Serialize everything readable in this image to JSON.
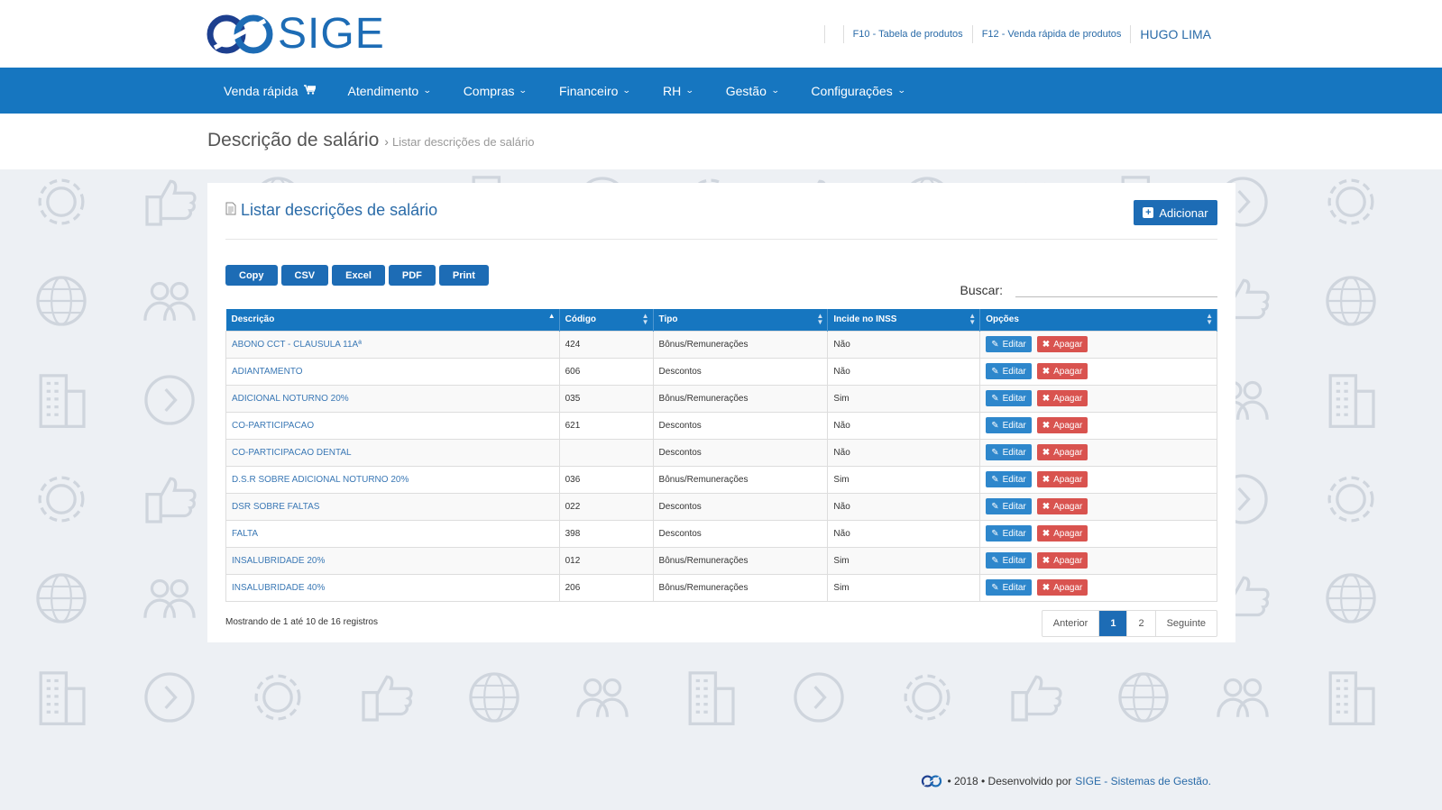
{
  "brand": {
    "name": "SIGE",
    "color": "#1d6cb5"
  },
  "top_links": {
    "f10": "F10 - Tabela de produtos",
    "f12": "F12 - Venda rápida de produtos",
    "user": "HUGO LIMA"
  },
  "nav": {
    "items": [
      {
        "label": "Venda rápida",
        "icon": "cart-icon"
      },
      {
        "label": "Atendimento",
        "icon": "chevron-down-icon"
      },
      {
        "label": "Compras",
        "icon": "chevron-down-icon"
      },
      {
        "label": "Financeiro",
        "icon": "chevron-down-icon"
      },
      {
        "label": "RH",
        "icon": "chevron-down-icon"
      },
      {
        "label": "Gestão",
        "icon": "chevron-down-icon"
      },
      {
        "label": "Configurações",
        "icon": "chevron-down-icon"
      }
    ]
  },
  "page_header": {
    "title": "Descrição de salário",
    "breadcrumb_sep": "›",
    "breadcrumb": "Listar descrições de salário"
  },
  "card": {
    "title": "Listar descrições de salário",
    "add_label": "Adicionar",
    "export_buttons": [
      "Copy",
      "CSV",
      "Excel",
      "PDF",
      "Print"
    ],
    "search_label": "Buscar:",
    "search_value": ""
  },
  "table": {
    "headers": [
      "Descrição",
      "Código",
      "Tipo",
      "Incide no INSS",
      "Opções"
    ],
    "edit_label": "Editar",
    "delete_label": "Apagar",
    "rows": [
      {
        "descricao": "ABONO CCT - CLAUSULA 11Aª",
        "codigo": "424",
        "tipo": "Bônus/Remunerações",
        "inss": "Não"
      },
      {
        "descricao": "ADIANTAMENTO",
        "codigo": "606",
        "tipo": "Descontos",
        "inss": "Não"
      },
      {
        "descricao": "ADICIONAL NOTURNO 20%",
        "codigo": "035",
        "tipo": "Bônus/Remunerações",
        "inss": "Sim"
      },
      {
        "descricao": "CO-PARTICIPACAO",
        "codigo": "621",
        "tipo": "Descontos",
        "inss": "Não"
      },
      {
        "descricao": "CO-PARTICIPACAO DENTAL",
        "codigo": "",
        "tipo": "Descontos",
        "inss": "Não"
      },
      {
        "descricao": "D.S.R SOBRE ADICIONAL NOTURNO 20%",
        "codigo": "036",
        "tipo": "Bônus/Remunerações",
        "inss": "Sim"
      },
      {
        "descricao": "DSR SOBRE FALTAS",
        "codigo": "022",
        "tipo": "Descontos",
        "inss": "Não"
      },
      {
        "descricao": "FALTA",
        "codigo": "398",
        "tipo": "Descontos",
        "inss": "Não"
      },
      {
        "descricao": "INSALUBRIDADE 20%",
        "codigo": "012",
        "tipo": "Bônus/Remunerações",
        "inss": "Sim"
      },
      {
        "descricao": "INSALUBRIDADE 40%",
        "codigo": "206",
        "tipo": "Bônus/Remunerações",
        "inss": "Sim"
      }
    ]
  },
  "pagination": {
    "info": "Mostrando de 1 até 10 de 16 registros",
    "prev": "Anterior",
    "pages": [
      "1",
      "2"
    ],
    "next": "Seguinte",
    "active_page": "1"
  },
  "footer": {
    "text": "• 2018 • Desenvolvido por",
    "link": "SIGE - Sistemas de Gestão."
  }
}
